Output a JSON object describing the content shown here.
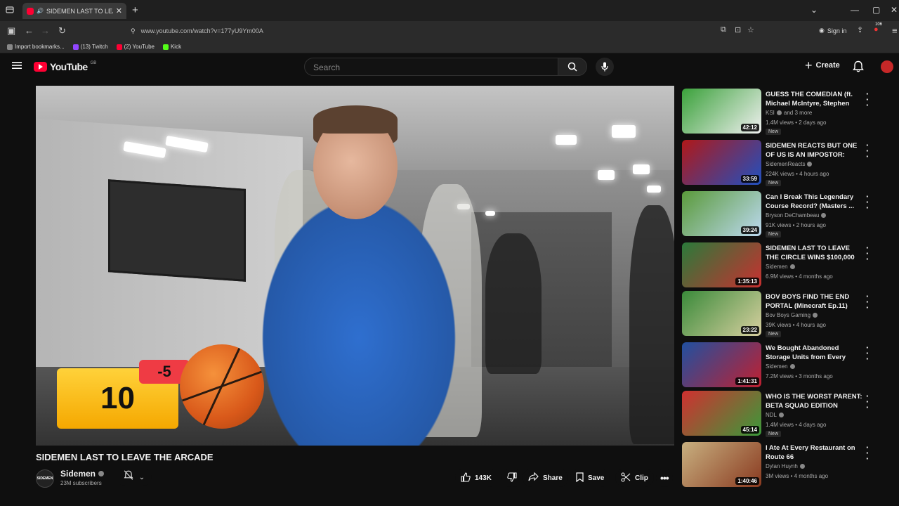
{
  "browser": {
    "tab_title": "SIDEMEN LAST TO LEAVE T",
    "url": "www.youtube.com/watch?v=177yU9Ym00A",
    "signin_label": "Sign in",
    "extension_badge": "106",
    "bookmarks": [
      {
        "label": "Import bookmarks...",
        "color": "#888888"
      },
      {
        "label": "(13) Twitch",
        "color": "#9146ff"
      },
      {
        "label": "(2) YouTube",
        "color": "#ff0033"
      },
      {
        "label": "Kick",
        "color": "#53fc18"
      }
    ]
  },
  "youtube": {
    "logo_text": "YouTube",
    "country_code": "GB",
    "search_placeholder": "Search",
    "create_label": "Create"
  },
  "player": {
    "score": "10",
    "score_delta": "-5"
  },
  "video": {
    "title": "SIDEMEN LAST TO LEAVE THE ARCADE",
    "channel": "Sidemen",
    "channel_avatar_text": "SIDEMEN",
    "subscribers": "23M subscribers",
    "likes": "143K",
    "share_label": "Share",
    "save_label": "Save",
    "clip_label": "Clip"
  },
  "recommendations": [
    {
      "title": "GUESS THE COMEDIAN (ft. Michael McIntyre, Stephen Tri...",
      "channel": "KSI",
      "channel_extra": "and 3 more",
      "meta": "1.4M views • 2 days ago",
      "duration": "42:12",
      "is_new": true,
      "badge": "New",
      "thumb_colors": [
        "#3aa13a",
        "#f0f0f0"
      ]
    },
    {
      "title": "SIDEMEN REACTS BUT ONE OF US IS AN IMPOSTOR: TIKTOK ...",
      "channel": "SidemenReacts",
      "channel_extra": "",
      "meta": "224K views • 4 hours ago",
      "duration": "33:59",
      "is_new": true,
      "badge": "New",
      "thumb_colors": [
        "#b01818",
        "#2050c0"
      ]
    },
    {
      "title": "Can I Break This Legendary Course Record? (Masters ...",
      "channel": "Bryson DeChambeau",
      "channel_extra": "",
      "meta": "91K views • 2 hours ago",
      "duration": "39:24",
      "is_new": true,
      "badge": "New",
      "thumb_colors": [
        "#5a9a3a",
        "#bcd9f0"
      ]
    },
    {
      "title": "SIDEMEN LAST TO LEAVE THE CIRCLE WINS $100,000",
      "channel": "Sidemen",
      "channel_extra": "",
      "meta": "6.9M views • 4 months ago",
      "duration": "1:35:13",
      "is_new": false,
      "badge": "",
      "thumb_colors": [
        "#2a7a3a",
        "#c83030"
      ]
    },
    {
      "title": "BOV BOYS FIND THE END PORTAL (Minecraft Ep.11)",
      "channel": "Bov Boys Gaming",
      "channel_extra": "",
      "meta": "39K views • 4 hours ago",
      "duration": "23:22",
      "is_new": true,
      "badge": "New",
      "thumb_colors": [
        "#3a8a3a",
        "#d8d0a0"
      ]
    },
    {
      "title": "We Bought Abandoned Storage Units from Every Continent an...",
      "channel": "Sidemen",
      "channel_extra": "",
      "meta": "7.2M views • 3 months ago",
      "duration": "1:41:31",
      "is_new": false,
      "badge": "",
      "thumb_colors": [
        "#2050a0",
        "#c02030"
      ]
    },
    {
      "title": "WHO IS THE WORST PARENT: BETA SQUAD EDITION",
      "channel": "NDL",
      "channel_extra": "",
      "meta": "1.4M views • 4 days ago",
      "duration": "45:14",
      "is_new": true,
      "badge": "New",
      "thumb_colors": [
        "#d03030",
        "#3a9a3a"
      ]
    },
    {
      "title": "I Ate At Every Restaurant on Route 66",
      "channel": "Dylan Huynh",
      "channel_extra": "",
      "meta": "3M views • 4 months ago",
      "duration": "1:40:46",
      "is_new": false,
      "badge": "",
      "thumb_colors": [
        "#c8b080",
        "#8a3a20"
      ]
    }
  ]
}
